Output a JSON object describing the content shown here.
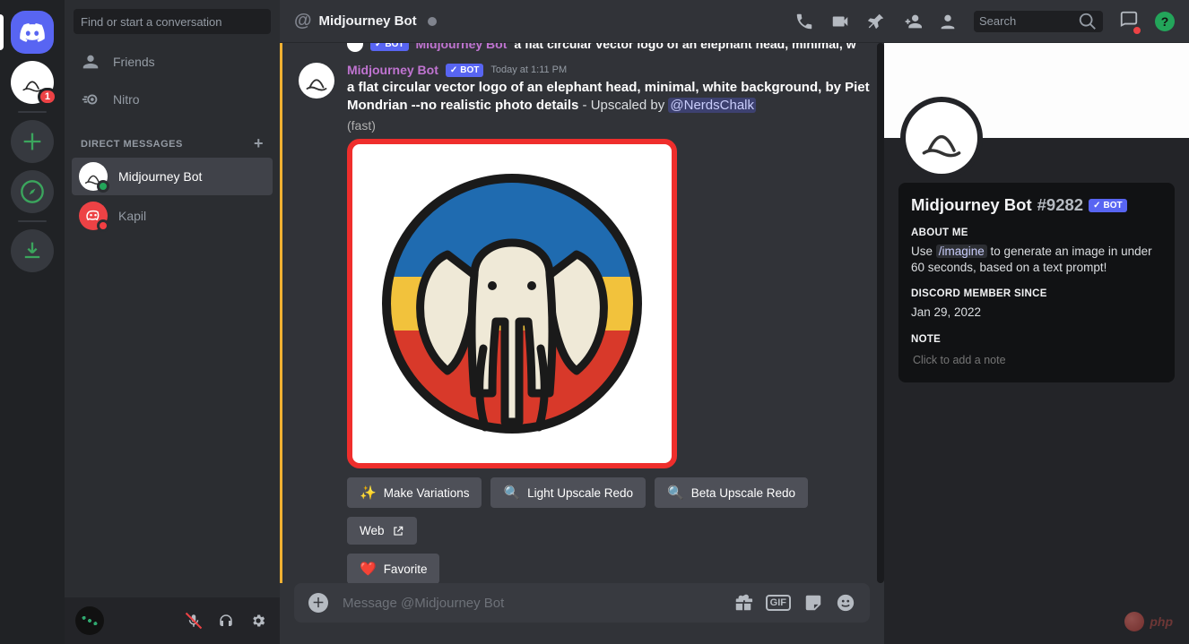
{
  "rail": {
    "dm_badge": "1"
  },
  "sidebar": {
    "find_placeholder": "Find or start a conversation",
    "nav": {
      "friends": "Friends",
      "nitro": "Nitro"
    },
    "dm_header": "DIRECT MESSAGES",
    "dms": [
      {
        "name": "Midjourney Bot"
      },
      {
        "name": "Kapil"
      }
    ]
  },
  "topbar": {
    "at": "@",
    "title": "Midjourney Bot",
    "search_placeholder": "Search"
  },
  "prev_msg": {
    "bot_tag": "BOT",
    "author": "Midjourney Bot",
    "text": "a flat circular vector logo of an elephant head, minimal, w"
  },
  "msg": {
    "author": "Midjourney Bot",
    "bot_tag": "BOT",
    "timestamp": "Today at 1:11 PM",
    "prompt_bold": "a flat circular vector logo of an elephant head, minimal, white background, by Piet Mondrian --no realistic photo details",
    "upscaled_prefix": " - Upscaled by ",
    "mention": "@NerdsChalk",
    "fast_suffix": "(fast)",
    "buttons": {
      "variations": "Make Variations",
      "light": "Light Upscale Redo",
      "beta": "Beta Upscale Redo",
      "web": "Web",
      "favorite": "Favorite"
    }
  },
  "composer": {
    "placeholder": "Message @Midjourney Bot"
  },
  "profile": {
    "name": "Midjourney Bot",
    "discriminator": "#9282",
    "bot_tag": "BOT",
    "about_h": "ABOUT ME",
    "about_pre": "Use ",
    "about_cmd": "/imagine",
    "about_post": " to generate an image in under 60 seconds, based on a text prompt!",
    "member_h": "DISCORD MEMBER SINCE",
    "member_date": "Jan 29, 2022",
    "note_h": "NOTE",
    "note_placeholder": "Click to add a note"
  },
  "watermark": "php"
}
